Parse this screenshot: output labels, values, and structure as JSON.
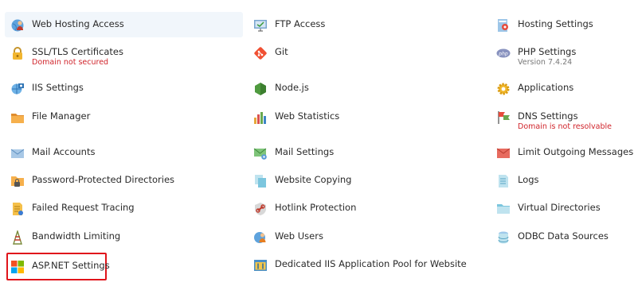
{
  "items": [
    {
      "key": "web-hosting-access",
      "label": "Web Hosting Access",
      "icon": "globe-user-icon"
    },
    {
      "key": "ftp-access",
      "label": "FTP Access",
      "icon": "monitor-ftp-icon"
    },
    {
      "key": "hosting-settings",
      "label": "Hosting Settings",
      "icon": "server-settings-icon"
    },
    {
      "key": "ssl-tls-certificates",
      "label": "SSL/TLS Certificates",
      "sub": "Domain not secured",
      "icon": "padlock-icon"
    },
    {
      "key": "git",
      "label": "Git",
      "icon": "git-icon"
    },
    {
      "key": "php-settings",
      "label": "PHP Settings",
      "sub": "Version 7.4.24",
      "icon": "php-icon"
    },
    {
      "key": "iis-settings",
      "label": "IIS Settings",
      "icon": "iis-globe-icon"
    },
    {
      "key": "nodejs",
      "label": "Node.js",
      "icon": "nodejs-hexagon-icon"
    },
    {
      "key": "applications",
      "label": "Applications",
      "icon": "gear-icon"
    },
    {
      "key": "file-manager",
      "label": "File Manager",
      "icon": "folder-icon"
    },
    {
      "key": "web-statistics",
      "label": "Web Statistics",
      "icon": "bar-chart-icon"
    },
    {
      "key": "dns-settings",
      "label": "DNS Settings",
      "sub": "Domain is not resolvable",
      "icon": "dns-flags-icon"
    },
    {
      "key": "mail-accounts",
      "label": "Mail Accounts",
      "icon": "envelope-icon"
    },
    {
      "key": "mail-settings",
      "label": "Mail Settings",
      "icon": "envelope-settings-icon"
    },
    {
      "key": "limit-outgoing-messages",
      "label": "Limit Outgoing Messages",
      "icon": "envelope-limit-icon"
    },
    {
      "key": "password-protected-directories",
      "label": "Password-Protected Directories",
      "icon": "locked-folder-icon"
    },
    {
      "key": "website-copying",
      "label": "Website Copying",
      "icon": "copy-pages-icon"
    },
    {
      "key": "logs",
      "label": "Logs",
      "icon": "log-document-icon"
    },
    {
      "key": "failed-request-tracing",
      "label": "Failed Request Tracing",
      "icon": "trace-document-icon"
    },
    {
      "key": "hotlink-protection",
      "label": "Hotlink Protection",
      "icon": "shield-link-icon"
    },
    {
      "key": "virtual-directories",
      "label": "Virtual Directories",
      "icon": "virtual-folder-icon"
    },
    {
      "key": "bandwidth-limiting",
      "label": "Bandwidth Limiting",
      "icon": "antenna-icon"
    },
    {
      "key": "web-users",
      "label": "Web Users",
      "icon": "web-users-icon"
    },
    {
      "key": "odbc-data-sources",
      "label": "ODBC Data Sources",
      "icon": "database-icon"
    },
    {
      "key": "aspnet-settings",
      "label": "ASP.NET Settings",
      "icon": "windows-logo-icon"
    },
    {
      "key": "dedicated-iis-app-pool",
      "label": "Dedicated IIS Application Pool for Website",
      "icon": "app-pool-icon"
    }
  ],
  "colors": {
    "hover_background": "#f1f6fb",
    "selection_border": "#e0141b",
    "error_text": "#d0242b",
    "muted_text": "#777777"
  }
}
